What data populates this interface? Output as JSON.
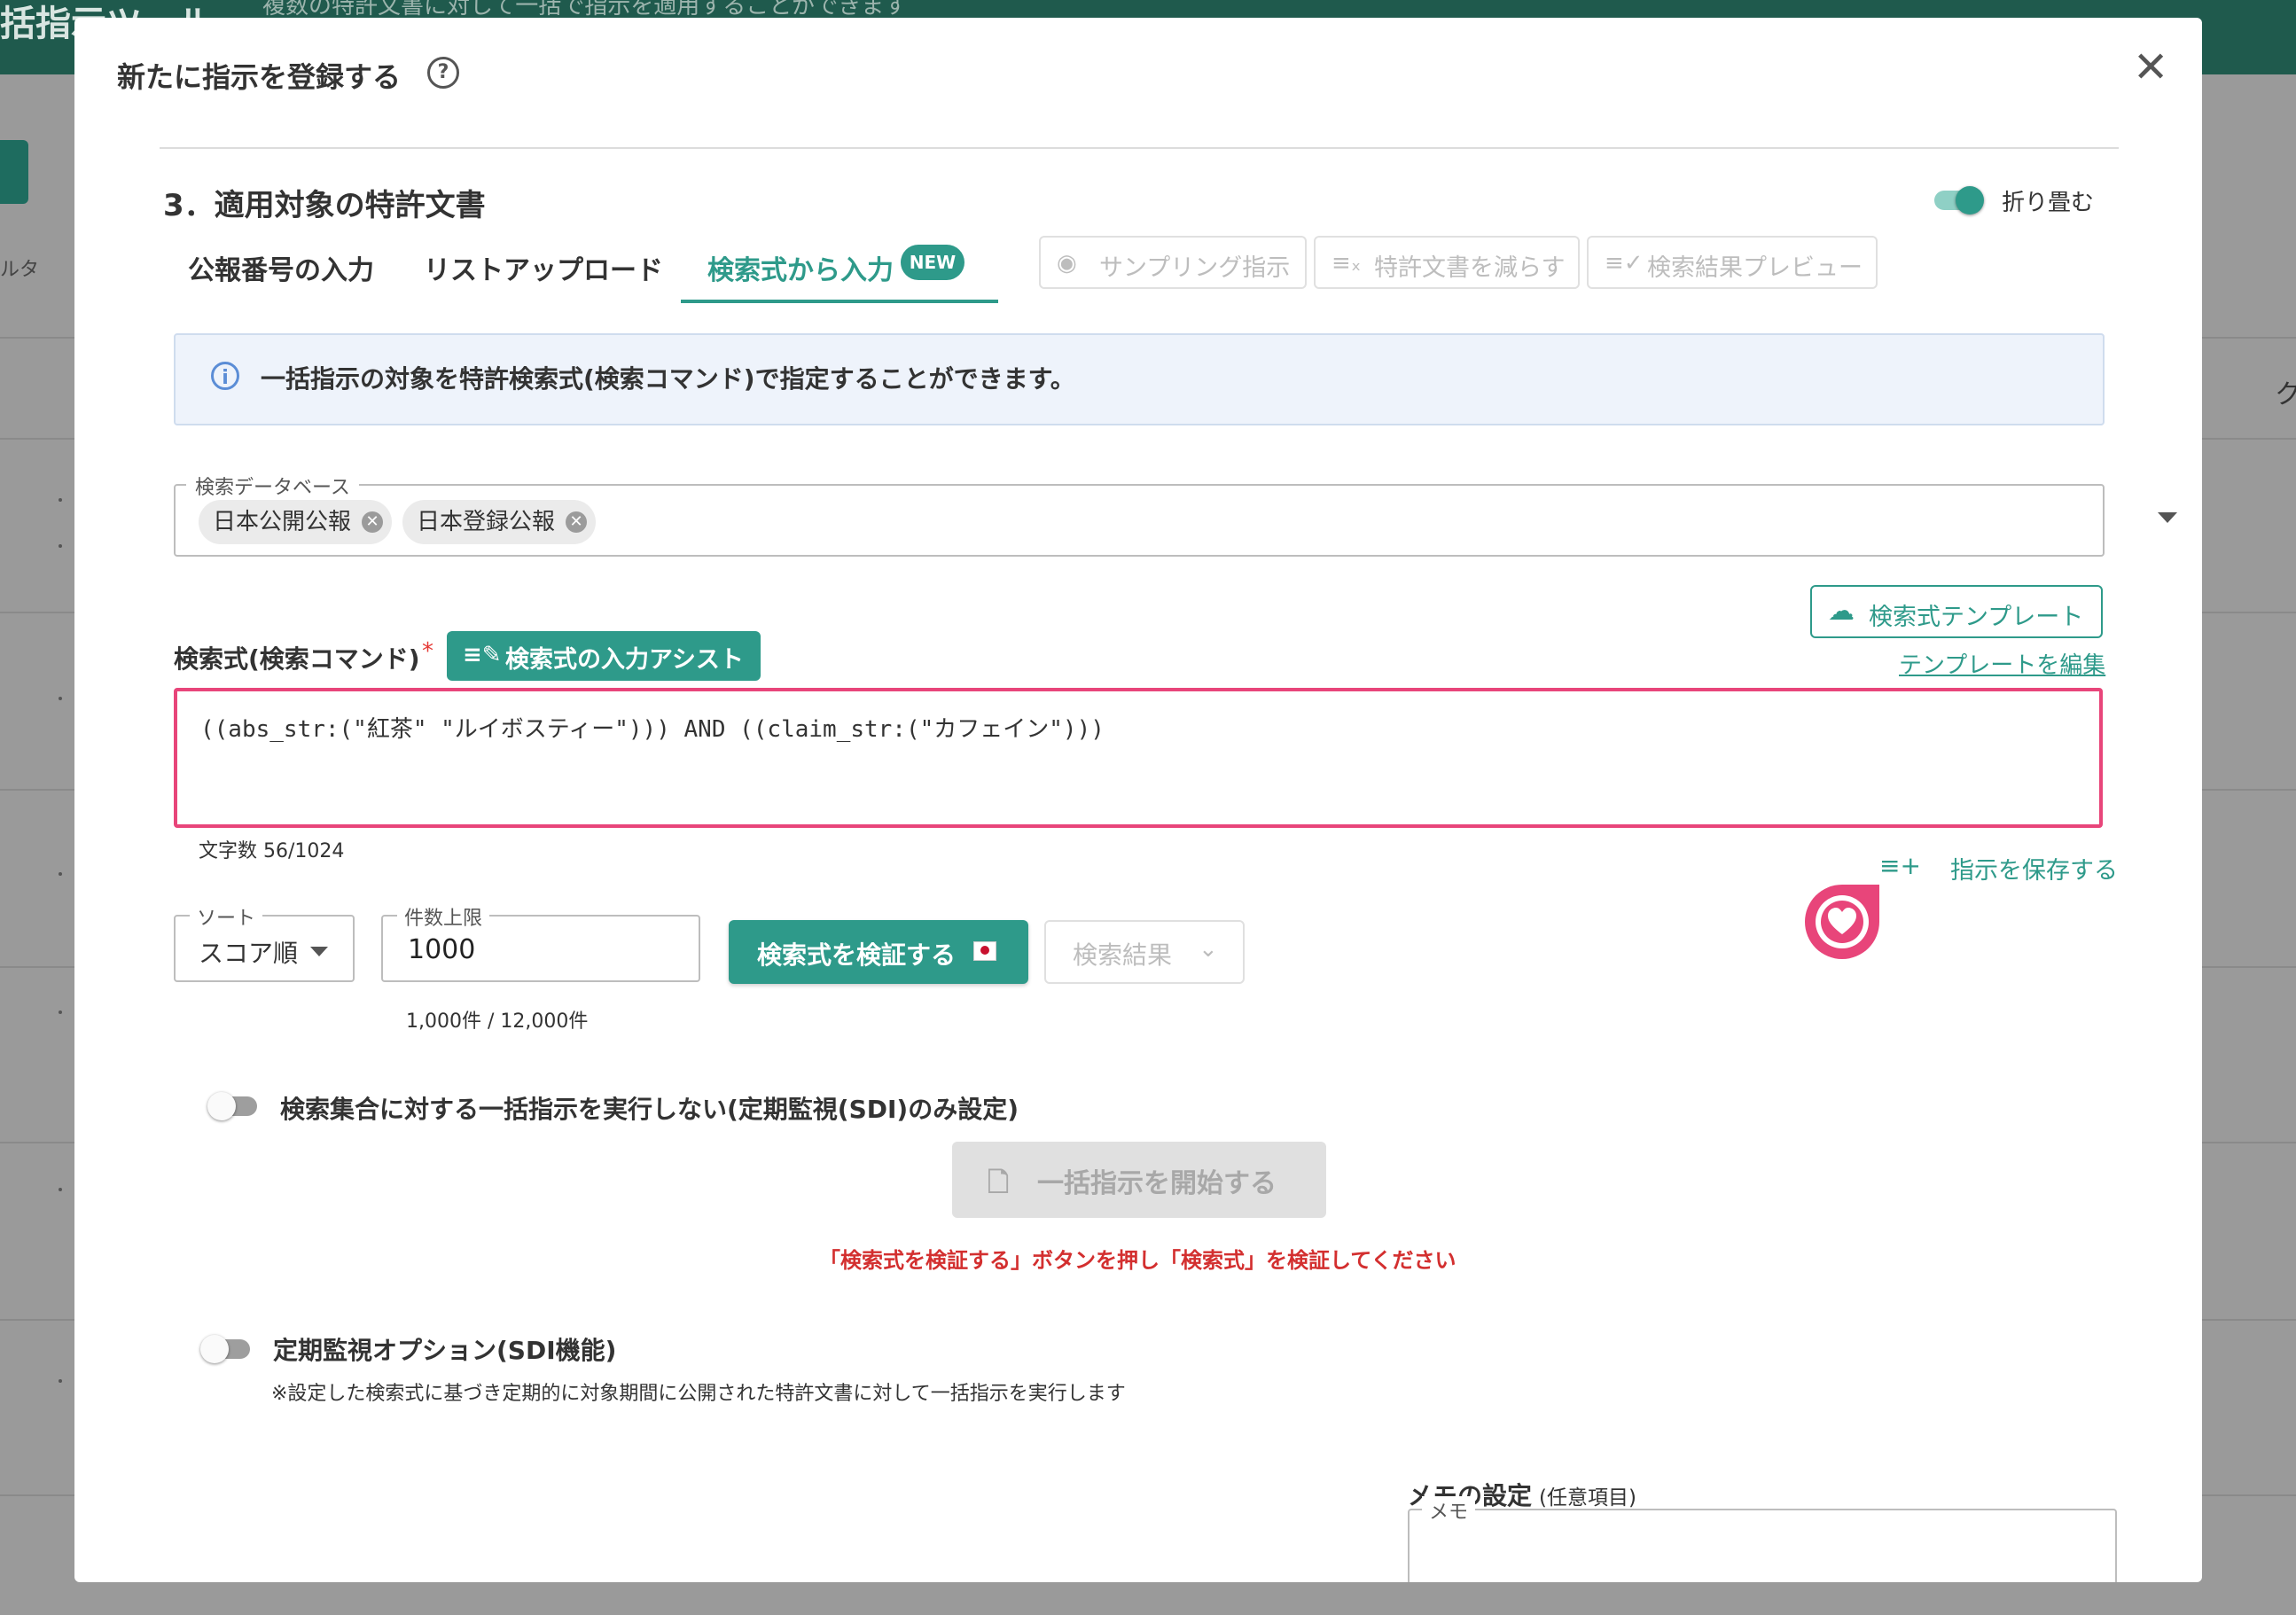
{
  "background": {
    "header_title": "括指示ツール",
    "header_subtitle": "複数の特許文書に対して一括で指示を適用することができます",
    "filter_label": "ルタ",
    "right_edge_text": "ク"
  },
  "modal": {
    "title": "新たに指示を登録する",
    "help_icon": "?",
    "close_icon": "✕"
  },
  "section": {
    "title": "3．適用対象の特許文書",
    "collapse_label": "折り畳む",
    "collapse_on": true
  },
  "tabs": [
    {
      "label": "公報番号の入力"
    },
    {
      "label": "リストアップロード"
    },
    {
      "label": "検索式から入力",
      "badge": "NEW",
      "active": true
    }
  ],
  "toolbar": {
    "sampling": "サンプリング指示",
    "reduce": "特許文書を減らす",
    "preview": "検索結果プレビュー"
  },
  "info": {
    "text": "一括指示の対象を特許検索式(検索コマンド)で指定することができます。"
  },
  "database": {
    "label": "検索データベース",
    "chips": [
      "日本公開公報",
      "日本登録公報"
    ]
  },
  "template": {
    "button": "検索式テンプレート",
    "edit_link": "テンプレートを編集"
  },
  "query": {
    "label": "検索式(検索コマンド)",
    "required": "*",
    "assist_button": "検索式の入力アシスト",
    "value": "((abs_str:(\"紅茶\" \"ルイボスティー\"))) AND ((claim_str:(\"カフェイン\")))",
    "char_count": "文字数 56/1024",
    "save_link": "指示を保存する"
  },
  "sort": {
    "label": "ソート",
    "value": "スコア順"
  },
  "limit": {
    "label": "件数上限",
    "value": "1000",
    "hint": "1,000件 / 12,000件"
  },
  "verify_button": "検索式を検証する",
  "result_button": "検索結果",
  "no_exec": {
    "label": "検索集合に対する一括指示を実行しない(定期監視(SDI)のみ設定)",
    "on": false
  },
  "start_button": "一括指示を開始する",
  "warning": "「検索式を検証する」ボタンを押し「検索式」を検証してください",
  "sdi": {
    "label": "定期監視オプション(SDI機能)",
    "note": "※設定した検索式に基づき定期的に対象期間に公開された特許文書に対して一括指示を実行します",
    "on": false
  },
  "memo": {
    "title": "メモの設定",
    "optional": "(任意項目)",
    "field_label": "メモ"
  },
  "colors": {
    "accent": "#2e9a8a",
    "highlight": "#e8457a",
    "warning": "#d32f2f"
  }
}
